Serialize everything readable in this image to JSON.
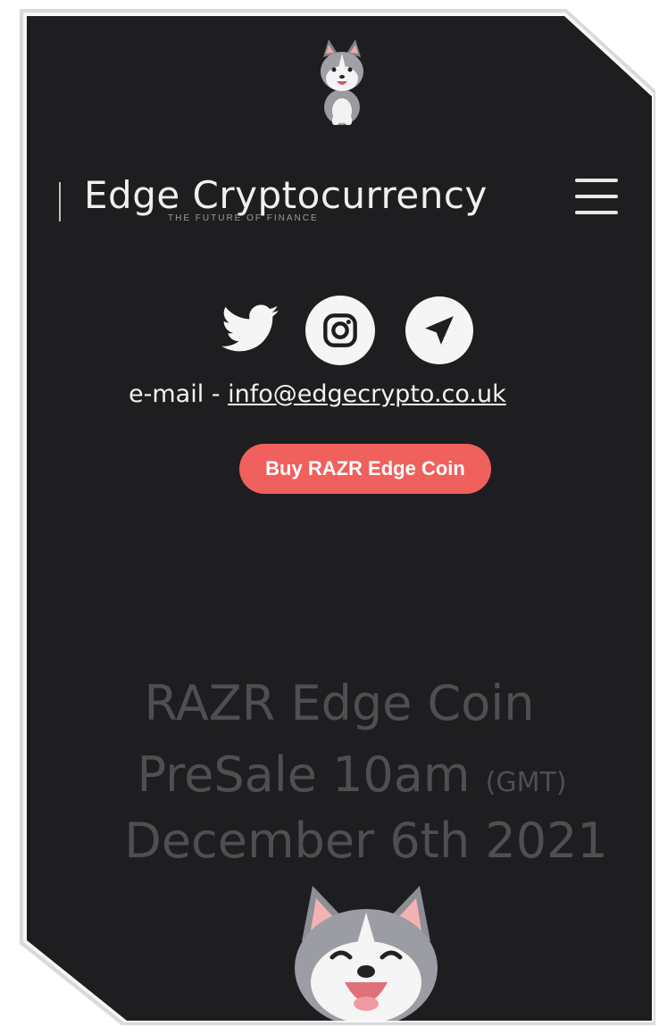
{
  "brand": {
    "title": "Edge Cryptocurrency",
    "subtitle": "THE FUTURE    OF FINANCE"
  },
  "icons": {
    "logo": "dog-mascot-icon",
    "menu": "hamburger-menu-icon",
    "twitter": "twitter-icon",
    "instagram": "instagram-icon",
    "telegram": "telegram-icon"
  },
  "contact": {
    "prefix": "e-mail - ",
    "email": "info@edgecrypto.co.uk"
  },
  "cta": {
    "buy_label": "Buy RAZR Edge Coin"
  },
  "headline": {
    "line1": "RAZR Edge Coin",
    "line2_main": "PreSale 10am ",
    "line2_suffix": "(GMT)",
    "line3": "December 6th 2021"
  },
  "colors": {
    "background": "#1e1e20",
    "accent": "#f0605c",
    "headline": "#4f4f52"
  }
}
